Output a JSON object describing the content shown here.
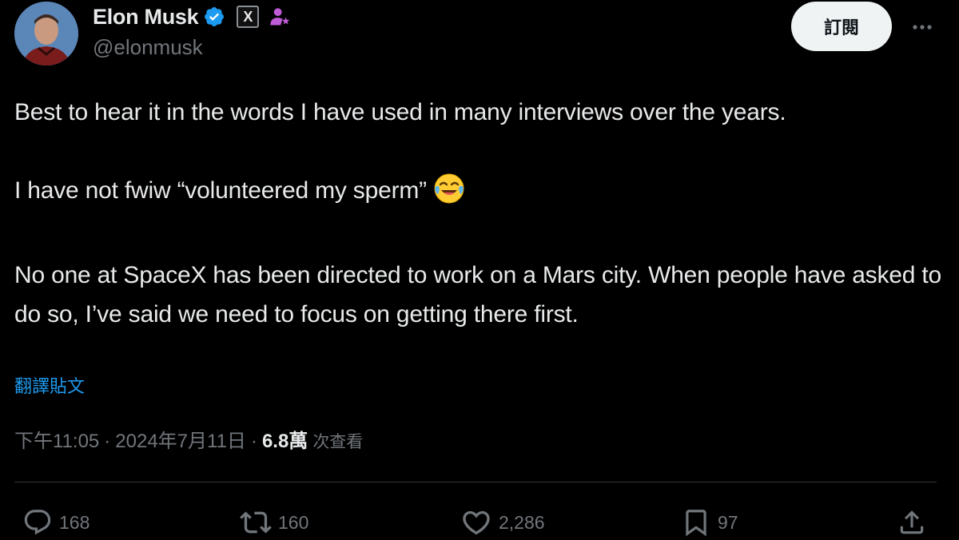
{
  "author": {
    "display_name": "Elon Musk",
    "handle": "@elonmusk",
    "verified": true,
    "affiliate_badge": "X",
    "avatar_icon": "profile-photo"
  },
  "header": {
    "subscribe_label": "訂閱",
    "more_icon": "more-horizontal-icon"
  },
  "tweet": {
    "paragraphs": [
      "Best to hear it in the words I have used in many interviews over the years.",
      "I have not fwiw “volunteered my sperm”",
      "No one at SpaceX has been directed to work on a Mars city. When people have asked to do so, I’ve said we need to focus on getting there first."
    ],
    "emoji": "face-with-tears-of-joy",
    "translate_label": "翻譯貼文"
  },
  "meta": {
    "time": "下午11:05",
    "separator": "·",
    "date": "2024年7月11日",
    "views_count": "6.8萬",
    "views_label": "次查看"
  },
  "actions": {
    "replies": "168",
    "reposts": "160",
    "likes": "2,286",
    "bookmarks": "97"
  },
  "colors": {
    "background": "#000000",
    "text": "#e7e9ea",
    "secondary": "#71767b",
    "accent": "#1d9bf0",
    "divider": "#2f3336",
    "verified": "#1d9bf0",
    "affiliate": "#c05bd8"
  }
}
